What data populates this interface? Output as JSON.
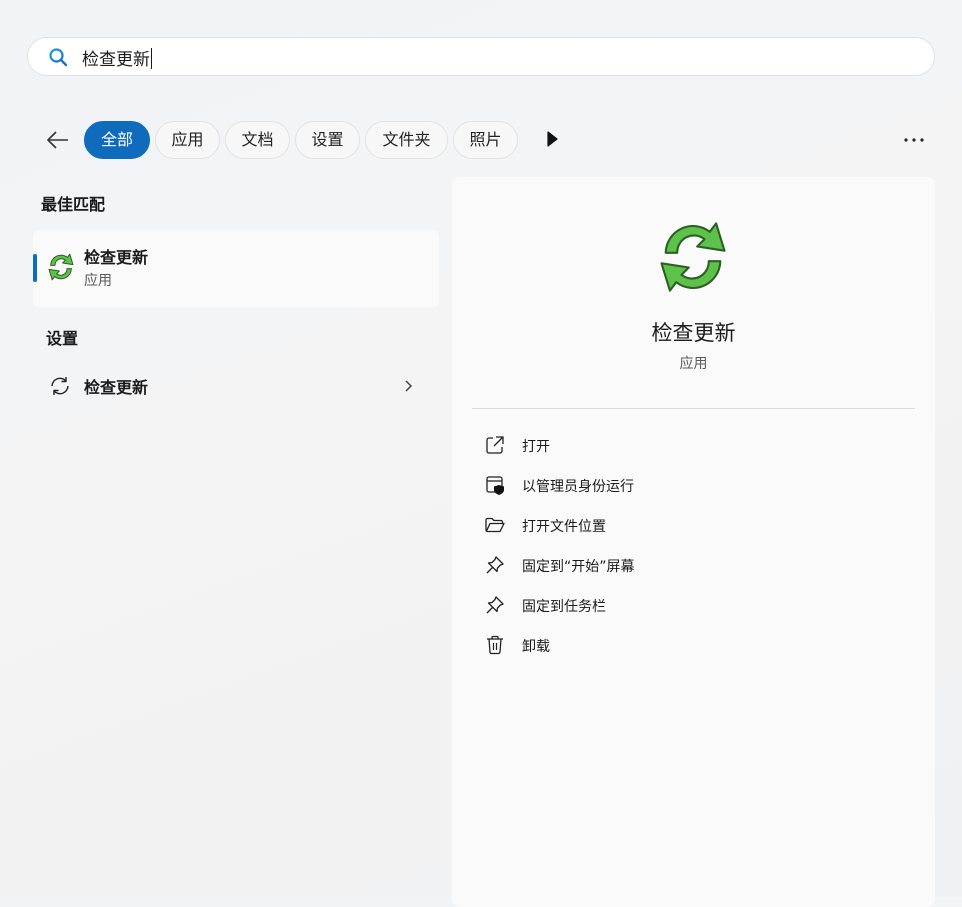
{
  "search": {
    "query": "检查更新"
  },
  "filters": [
    {
      "label": "全部",
      "active": true
    },
    {
      "label": "应用"
    },
    {
      "label": "文档"
    },
    {
      "label": "设置"
    },
    {
      "label": "文件夹"
    },
    {
      "label": "照片"
    }
  ],
  "sections": {
    "best_match_title": "最佳匹配",
    "settings_title": "设置"
  },
  "best_match": {
    "name": "检查更新",
    "type": "应用",
    "icon": "refresh-green-icon"
  },
  "settings_result": {
    "name": "检查更新",
    "icon": "refresh-outline-icon"
  },
  "detail": {
    "title": "检查更新",
    "subtitle": "应用",
    "actions": [
      {
        "label": "打开",
        "icon": "open-external-icon"
      },
      {
        "label": "以管理员身份运行",
        "icon": "shield-admin-icon"
      },
      {
        "label": "打开文件位置",
        "icon": "folder-icon"
      },
      {
        "label": "固定到“开始”屏幕",
        "icon": "pin-icon"
      },
      {
        "label": "固定到任务栏",
        "icon": "pin-icon"
      },
      {
        "label": "卸载",
        "icon": "trash-icon"
      }
    ]
  },
  "colors": {
    "accent": "#0f6cbd",
    "icon_green": "#5cc24a"
  }
}
